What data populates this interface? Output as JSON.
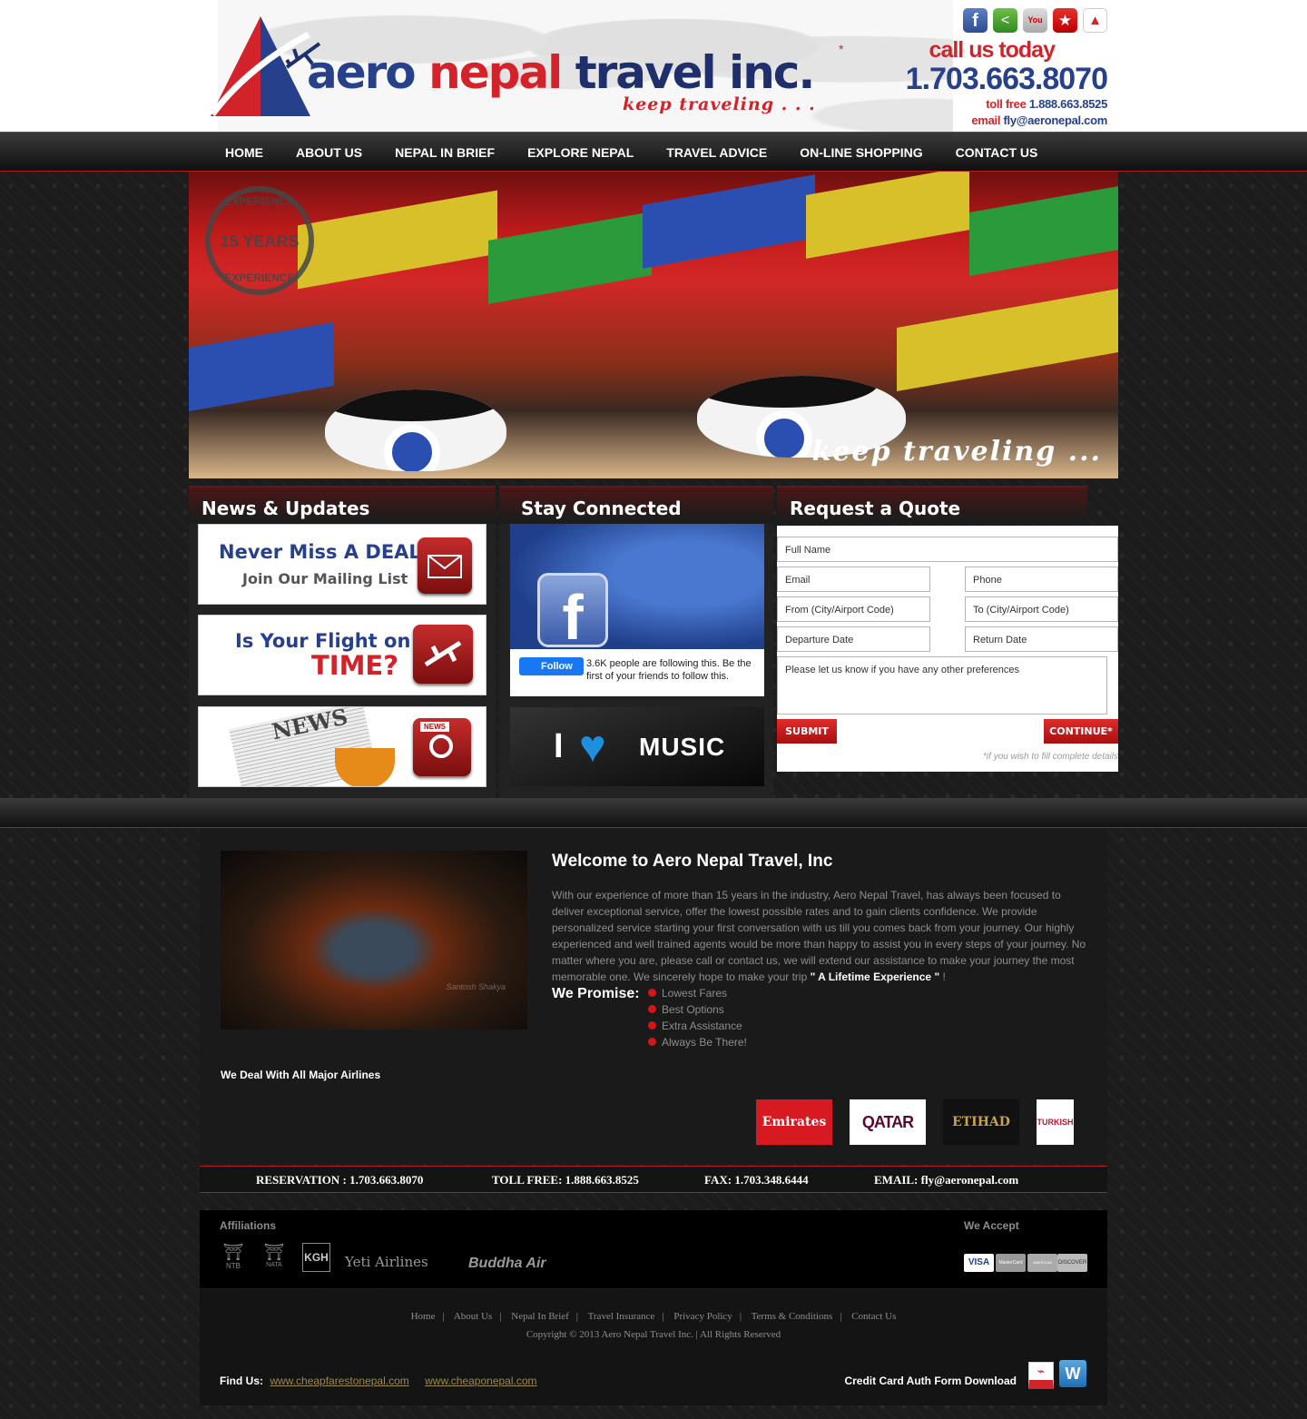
{
  "brand": {
    "logo_words": [
      "aero",
      "nepal",
      "travel inc."
    ],
    "tagline": "keep traveling . . ."
  },
  "header": {
    "call_label": "call us today",
    "phone": "1.703.663.8070",
    "tollfree_label": "toll free",
    "tollfree": "1.888.663.8525",
    "email_label": "email",
    "email": "fly@aeronepal.com",
    "social_icons": [
      "facebook-icon",
      "share-icon",
      "youtube-icon",
      "favorite-star-icon",
      "aeronepal-icon"
    ]
  },
  "nav": [
    "HOME",
    "ABOUT US",
    "NEPAL IN BRIEF",
    "EXPLORE NEPAL",
    "TRAVEL ADVICE",
    "ON-LINE SHOPPING",
    "CONTACT US"
  ],
  "banner": {
    "stamp_top": "EXPERIENCE",
    "stamp_years": "15 YEARS",
    "stamp_bottom": "EXPERIENCE",
    "caption": "keep traveling ..."
  },
  "news": {
    "title": "News & Updates",
    "deal_line1": "Never Miss A DEAL!",
    "deal_line2": "Join Our Mailing List",
    "flight_line1": "Is Your Flight on",
    "flight_line2": "TIME?",
    "news_banner_word": "NEWS",
    "news_icon_word": "NEWS"
  },
  "social": {
    "title": "Stay Connected",
    "follow_label": "Follow",
    "follow_text": "3.6K people are following this. Be the first of your friends to follow this.",
    "music_text": "MUSIC",
    "music_prefix": "I"
  },
  "quote": {
    "title": "Request a Quote",
    "full_name": "Full Name",
    "email": "Email",
    "phone": "Phone",
    "from": "From (City/Airport Code)",
    "to": "To (City/Airport Code)",
    "departure": "Departure Date",
    "return": "Return Date",
    "prefs": "Please let us know if you have any other preferences",
    "submit": "SUBMIT",
    "continue": "CONTINUE*",
    "note": "*if you wish to fill complete details"
  },
  "welcome": {
    "title": "Welcome to Aero Nepal Travel, Inc",
    "body": "With our experience of more than 15 years in the industry, Aero Nepal Travel, has always been focused to deliver exceptional service, offer the lowest possible rates and to gain clients confidence. We provide personalized service starting your first conversation with us till you comes back from your journey. Our highly experienced and well trained agents would be more than happy to assist you in every steps of your journey. No matter where you are, please call or contact us, we will extend our assistance to make your journey the most memorable one. We sincerely hope to make your trip",
    "highlight": "\" A Lifetime Experience \"",
    "end": "!",
    "promise_label": "We Promise:",
    "promises": [
      "Lowest Fares",
      "Best Options",
      "Extra Assistance",
      "Always Be There!"
    ],
    "image_credit": "Santosh Shakya"
  },
  "airlines": {
    "title": "We Deal With All Major Airlines",
    "logos": [
      "Emirates",
      "QATAR",
      "ETIHAD",
      "TURKISH"
    ]
  },
  "contact_bar": {
    "reservation": "RESERVATION : 1.703.663.8070",
    "tollfree": "TOLL FREE: 1.888.663.8525",
    "fax": "FAX: 1.703.348.6444",
    "email": "EMAIL: fly@aeronepal.com"
  },
  "affiliations": {
    "title": "Affiliations",
    "logos": [
      "NTB",
      "NATA",
      "KGH",
      "Yeti Airlines",
      "Buddha Air"
    ],
    "accept_title": "We Accept",
    "cards": [
      "VISA",
      "MasterCard",
      "AMERICAN EXPRESS",
      "DISCOVER"
    ]
  },
  "footer": {
    "links": [
      "Home",
      "About Us",
      "Nepal In Brief",
      "Travel Insurance",
      "Privacy Policy",
      "Terms & Conditions",
      "Contact Us"
    ],
    "copyright": "Copyright © 2013 Aero Nepal Travel Inc. | All Rights Reserved",
    "find_label": "Find Us:",
    "find_links": [
      "www.cheapfarestonepal.com",
      "www.cheaponepal.com"
    ],
    "cc_label": "Credit Card Auth Form Download",
    "doc_icons": [
      "pdf-icon",
      "word-icon"
    ]
  },
  "colors": {
    "brand_red": "#d2232a",
    "brand_blue": "#27408b",
    "dark_bg": "#1c1c1c"
  }
}
